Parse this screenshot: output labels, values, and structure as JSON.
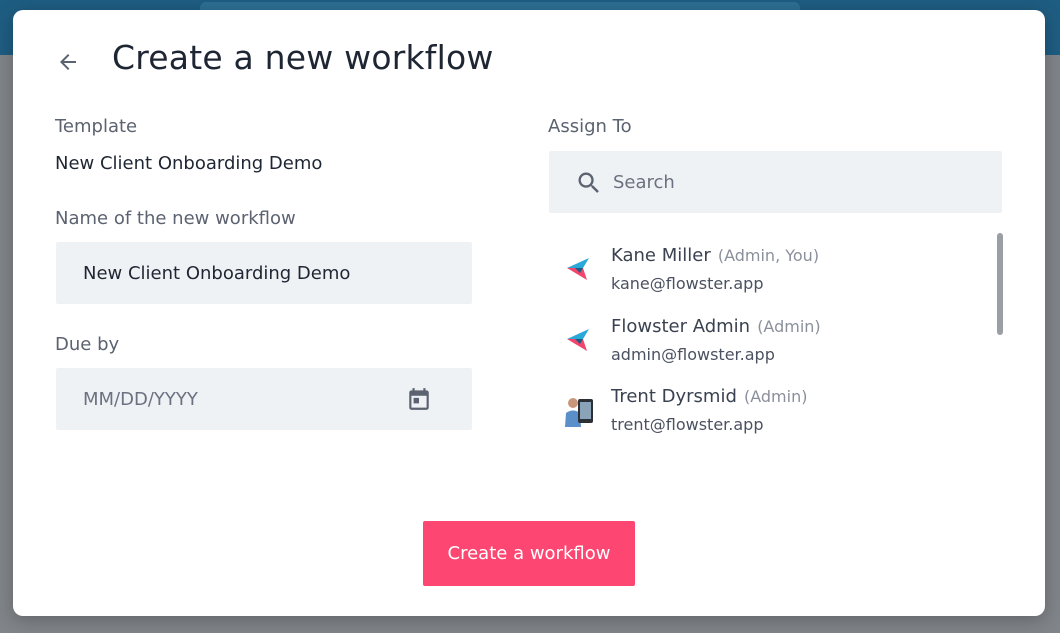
{
  "dialog": {
    "title": "Create a new workflow",
    "template_label": "Template",
    "template_value": "New Client Onboarding Demo",
    "name_label": "Name of the new workflow",
    "name_value": "New Client Onboarding Demo",
    "due_label": "Due by",
    "due_placeholder": "MM/DD/YYYY",
    "assign_label": "Assign To",
    "search_placeholder": "Search",
    "create_button": "Create a workflow"
  },
  "users": [
    {
      "name": "Kane Miller",
      "role": "(Admin, You)",
      "email": "kane@flowster.app",
      "avatar": "flowster-logo-icon"
    },
    {
      "name": "Flowster Admin",
      "role": "(Admin)",
      "email": "admin@flowster.app",
      "avatar": "flowster-logo-icon"
    },
    {
      "name": "Trent Dyrsmid",
      "role": "(Admin)",
      "email": "trent@flowster.app",
      "avatar": "user-photo"
    }
  ],
  "colors": {
    "accent": "#fe4672",
    "field_bg": "#eff2f5",
    "backdrop_header": "#1e5d82"
  }
}
